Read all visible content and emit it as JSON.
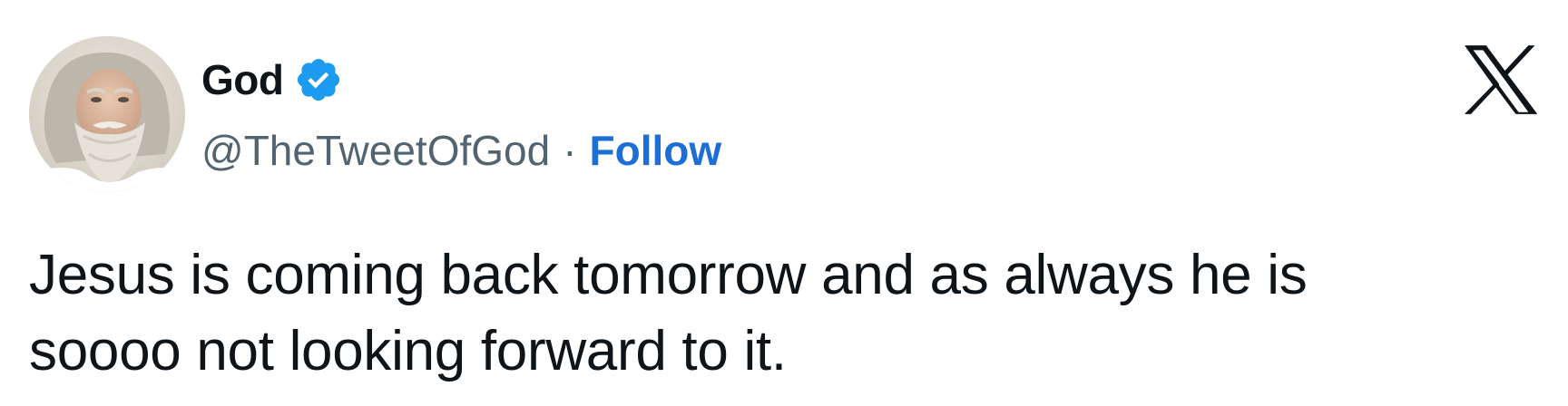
{
  "tweet": {
    "author": {
      "display_name": "God",
      "handle": "@TheTweetOfGod",
      "verified": true,
      "avatar_icon": "bearded-man-avatar"
    },
    "separator": "·",
    "follow_label": "Follow",
    "text": "Jesus is coming back tomorrow and as always he is\nsoooo not looking forward to it.",
    "platform_icon": "x-logo-icon"
  },
  "colors": {
    "text_primary": "#0f1419",
    "text_secondary": "#536471",
    "follow_link": "#1d6fd6",
    "verified_badge": "#1d9bf0"
  }
}
